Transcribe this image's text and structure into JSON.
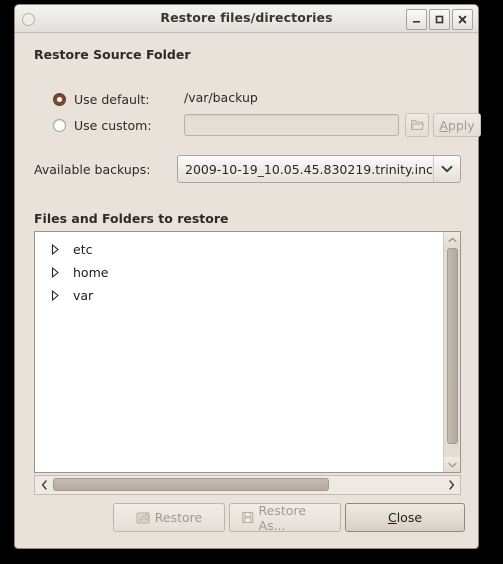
{
  "window": {
    "title": "Restore files/directories",
    "controls": {
      "minimize": "minimize",
      "maximize": "maximize",
      "close": "close"
    }
  },
  "source_section": {
    "label": "Restore Source Folder",
    "default_option": {
      "label": "Use default:",
      "selected": true,
      "path": "/var/backup"
    },
    "custom_option": {
      "label": "Use custom:",
      "selected": false,
      "value": "",
      "placeholder": ""
    },
    "browse_icon": "folder-open-icon",
    "apply_label_before": "",
    "apply_label_mnemonic": "A",
    "apply_label_after": "pply"
  },
  "backups": {
    "label": "Available backups:",
    "selected": "2009-10-19_10.05.45.830219.trinity.inc",
    "arrow_icon": "chevron-down-icon"
  },
  "files_section": {
    "label": "Files and Folders to restore",
    "rows": [
      {
        "name": "etc",
        "expanded": false
      },
      {
        "name": "home",
        "expanded": false
      },
      {
        "name": "var",
        "expanded": false
      }
    ]
  },
  "buttons": {
    "restore": {
      "label": "Restore",
      "enabled": false,
      "icon": "revert-icon"
    },
    "restore_as": {
      "label": "Restore As...",
      "enabled": false,
      "icon": "save-as-icon"
    },
    "close_mnemonic": "C",
    "close_rest": "lose"
  },
  "colors": {
    "window_bg": "#e8e2da",
    "titlebar_bg": "#eceae6",
    "accent_radio": "#7a4a32",
    "list_bg": "#ffffff",
    "text": "#2e2a26",
    "disabled_text": "#a09993",
    "scroll_thumb": "#b8af a2"
  }
}
